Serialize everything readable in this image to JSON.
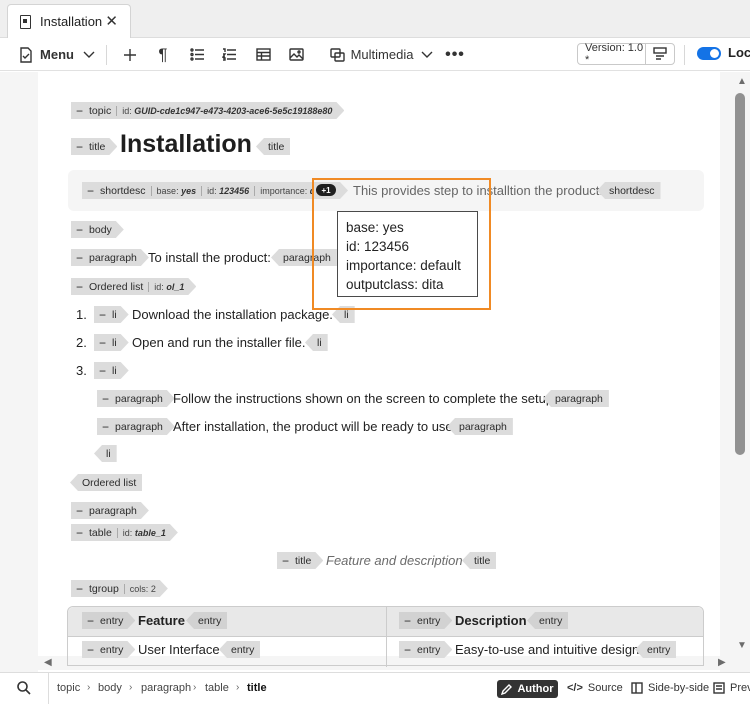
{
  "tab": {
    "title": "Installation"
  },
  "toolbar": {
    "menu_label": "Menu",
    "multimedia_label": "Multimedia",
    "version_label": "Version: 1.0 *",
    "lock_label": "Lock"
  },
  "doc": {
    "topic": {
      "tag": "topic",
      "attr_id": "id:",
      "id_value": "GUID-cde1c947-e473-4203-ace6-5e5c19188e80"
    },
    "title": {
      "open": "title",
      "text": "Installation",
      "close": "title"
    },
    "shortdesc": {
      "tag": "shortdesc",
      "base_label": "base:",
      "base_value": "yes",
      "id_label": "id:",
      "id_value": "123456",
      "importance_label": "importance:",
      "importance_value": "default",
      "more": "+1",
      "text": "This provides step to installtion the product.",
      "close": "shortdesc"
    },
    "tooltip": [
      "base: yes",
      "id: 123456",
      "importance: default",
      "outputclass: dita"
    ],
    "body": "body",
    "p1": {
      "tag": "paragraph",
      "text": "To install the product:",
      "close": "paragraph"
    },
    "ol": {
      "tag": "Ordered list",
      "id_label": "id:",
      "id_value": "ol_1",
      "close": "Ordered list"
    },
    "li1": {
      "num": "1.",
      "tag": "li",
      "text": "Download the installation package.",
      "close": "li"
    },
    "li2": {
      "num": "2.",
      "tag": "li",
      "text": "Open and run the installer file.",
      "close": "li"
    },
    "li3": {
      "num": "3.",
      "tag": "li",
      "close": "li"
    },
    "p2": {
      "tag": "paragraph",
      "text": "Follow the instructions shown on the screen to complete the setup.",
      "close": "paragraph"
    },
    "p3": {
      "tag": "paragraph",
      "text": "After installation, the product will be ready to use.",
      "close": "paragraph"
    },
    "p4": {
      "close": "paragraph"
    },
    "table": {
      "tag": "table",
      "id_label": "id:",
      "id_value": "table_1"
    },
    "table_title": {
      "open": "title",
      "text": "Feature and description",
      "close": "title"
    },
    "tgroup": {
      "tag": "tgroup",
      "cols_label": "cols:",
      "cols_value": "2"
    },
    "thead": [
      {
        "open": "entry",
        "text": "Feature",
        "close": "entry"
      },
      {
        "open": "entry",
        "text": "Description",
        "close": "entry"
      }
    ],
    "row1": [
      {
        "open": "entry",
        "text": "User Interface",
        "close": "entry"
      },
      {
        "open": "entry",
        "text": "Easy-to-use and intuitive design",
        "close": "entry"
      }
    ]
  },
  "breadcrumb": [
    "topic",
    "body",
    "paragraph",
    "table",
    "title"
  ],
  "status": {
    "author": "Author",
    "source": "Source",
    "side_by_side": "Side-by-side",
    "preview": "Preview"
  },
  "colors": {
    "accent": "#1473e6",
    "highlight": "#f08a24",
    "tag_bg": "#dcdcdc"
  }
}
